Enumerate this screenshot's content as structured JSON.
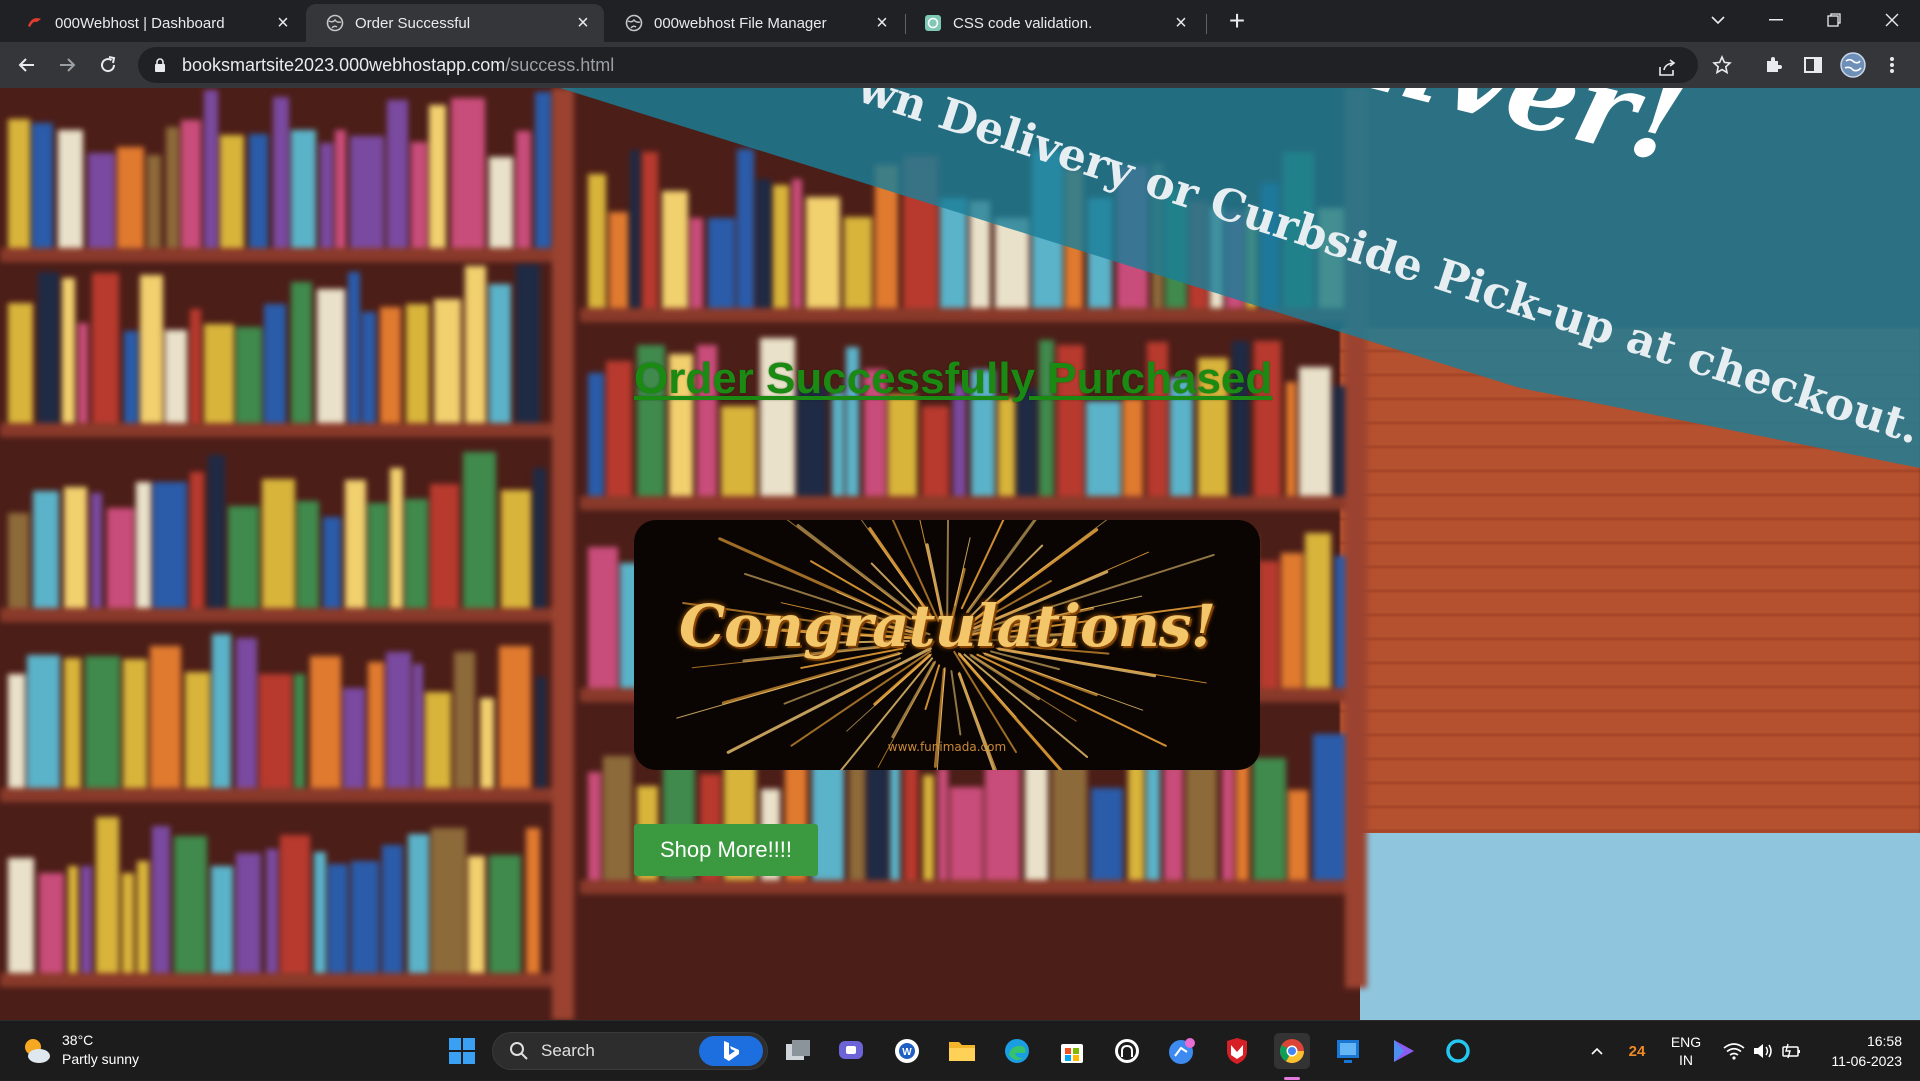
{
  "browser": {
    "tabs": [
      {
        "title": "000Webhost | Dashboard",
        "active": false
      },
      {
        "title": "Order Successful",
        "active": true
      },
      {
        "title": "000webhost File Manager",
        "active": false
      },
      {
        "title": "CSS code validation.",
        "active": false
      }
    ],
    "close_glyph": "×",
    "new_tab_glyph": "+",
    "url_host": "booksmartsite2023.000webhostapp.com",
    "url_path": "/success.html"
  },
  "page": {
    "banner_text": "wn Delivery or Curbside Pick-up at checkout.",
    "banner_big_text": "eliver!",
    "heading": "Order Successfully Purchased",
    "congrats_text": "Congratulations!",
    "congrats_watermark": "www.funimada.com",
    "shop_button": "Shop More!!!!"
  },
  "taskbar": {
    "weather_temp": "38°C",
    "weather_desc": "Partly sunny",
    "search_placeholder": "Search",
    "tray_badge": "24",
    "lang_top": "ENG",
    "lang_bottom": "IN",
    "time": "16:58",
    "date": "11-06-2023"
  },
  "colors": {
    "heading_green": "#1a8a12",
    "button_green": "#3b9a3f",
    "banner_teal": "#1b7f99"
  }
}
